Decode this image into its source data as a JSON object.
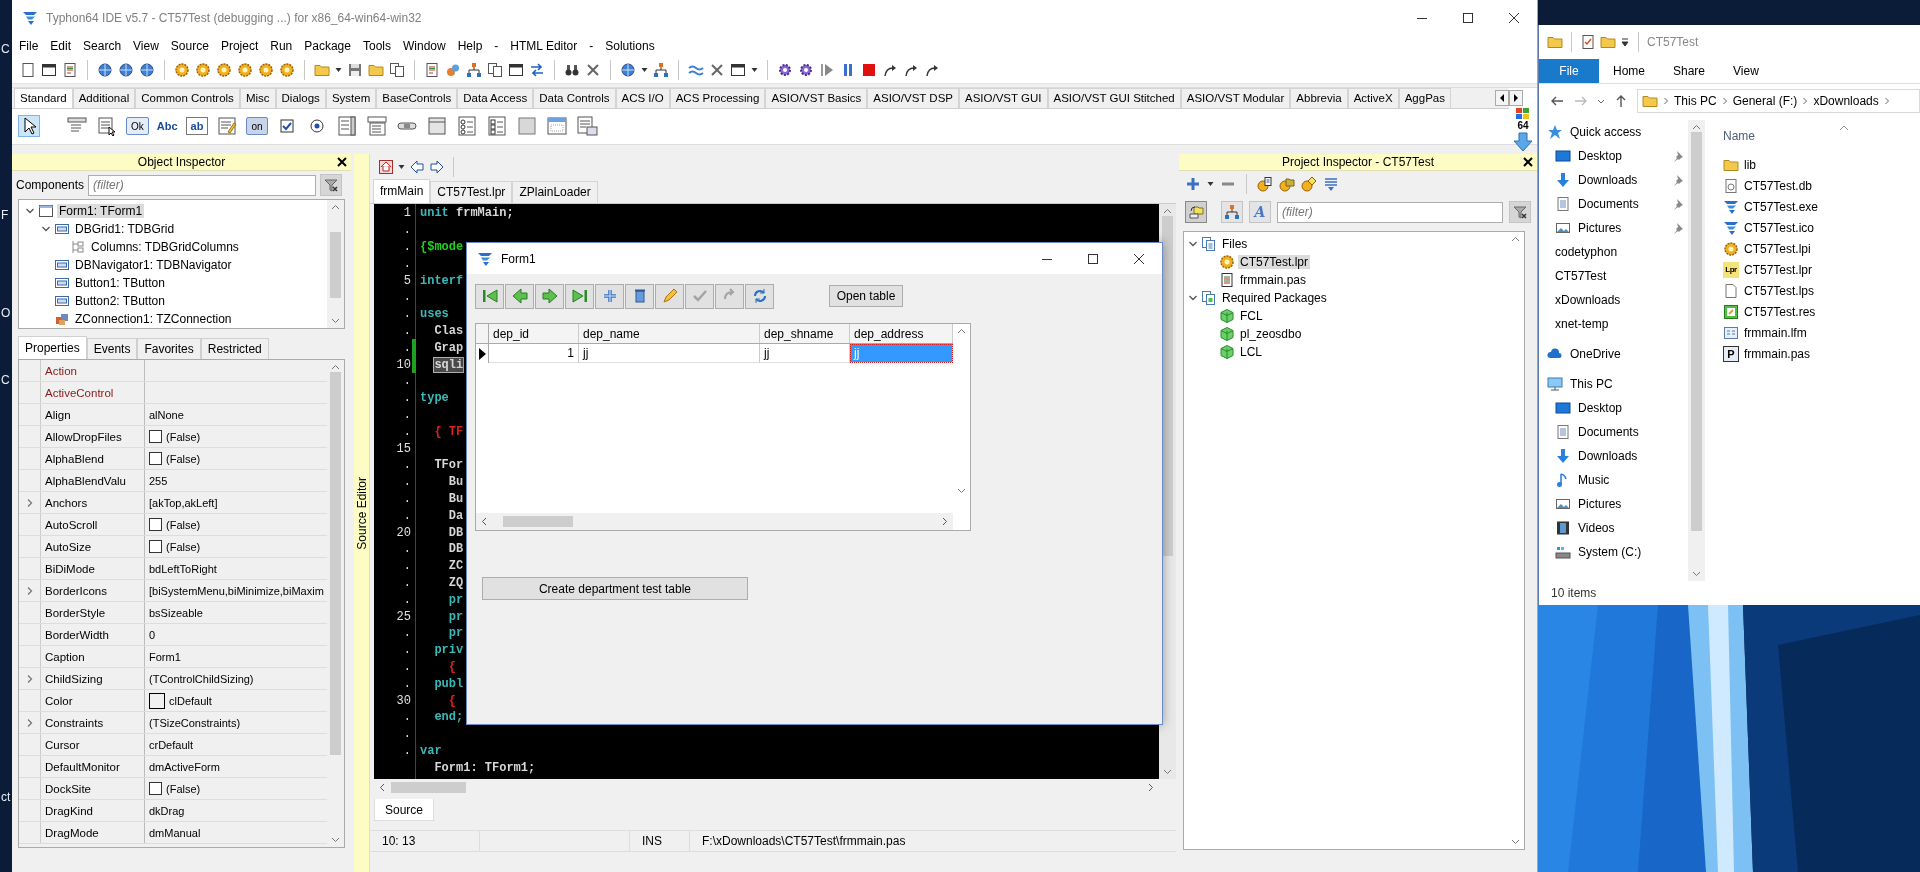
{
  "desktop": {
    "icon_labels": [
      "C",
      "F",
      "O",
      "C",
      "ct"
    ]
  },
  "ide": {
    "title": "Typhon64 IDE v5.7 - CT57Test (debugging ...) for x86_64-win64-win32",
    "menu": [
      "File",
      "Edit",
      "Search",
      "View",
      "Source",
      "Project",
      "Run",
      "Package",
      "Tools",
      "Window",
      "Help",
      "-",
      "HTML Editor",
      "-",
      "Solutions"
    ],
    "palette": {
      "tabs": [
        {
          "label": "Standard",
          "selected": true
        },
        {
          "label": "Additional",
          "selected": false
        },
        {
          "label": "Common Controls",
          "selected": false
        },
        {
          "label": "Misc",
          "selected": false
        },
        {
          "label": "Dialogs",
          "selected": false
        },
        {
          "label": "System",
          "selected": false
        },
        {
          "label": "BaseControls",
          "selected": false
        },
        {
          "label": "Data Access",
          "selected": false
        },
        {
          "label": "Data Controls",
          "selected": false
        },
        {
          "label": "ACS I/O",
          "selected": false
        },
        {
          "label": "ACS Processing",
          "selected": false
        },
        {
          "label": "ASIO/VST Basics",
          "selected": false
        },
        {
          "label": "ASIO/VST DSP",
          "selected": false
        },
        {
          "label": "ASIO/VST GUI",
          "selected": false
        },
        {
          "label": "ASIO/VST GUI Stitched",
          "selected": false
        },
        {
          "label": "ASIO/VST Modular",
          "selected": false
        },
        {
          "label": "Abbrevia",
          "selected": false
        },
        {
          "label": "ActiveX",
          "selected": false
        },
        {
          "label": "AggPas",
          "selected": false
        }
      ],
      "components": [
        {
          "kind": "pointer",
          "selected": true
        },
        {
          "kind": "menu",
          "selected": false
        },
        {
          "kind": "popup",
          "selected": false
        },
        {
          "kind": "button",
          "glyph": "Ok",
          "selected": false
        },
        {
          "kind": "label",
          "glyph": "Abc",
          "selected": false
        },
        {
          "kind": "edit",
          "glyph": "ab",
          "selected": false
        },
        {
          "kind": "memo",
          "selected": false
        },
        {
          "kind": "toggle",
          "glyph": "on",
          "selected": false
        },
        {
          "kind": "checkbox",
          "selected": false
        },
        {
          "kind": "radio",
          "selected": false
        },
        {
          "kind": "listbox",
          "selected": false
        },
        {
          "kind": "combobox",
          "selected": false
        },
        {
          "kind": "scrollbar",
          "selected": false
        },
        {
          "kind": "groupbox",
          "selected": false
        },
        {
          "kind": "radiogroup",
          "selected": false
        },
        {
          "kind": "checkgroup",
          "selected": false
        },
        {
          "kind": "panel",
          "selected": false
        },
        {
          "kind": "frame",
          "selected": false
        },
        {
          "kind": "actionlist",
          "selected": false
        }
      ],
      "badge": "64"
    },
    "object_inspector": {
      "title": "Object Inspector",
      "components_label": "Components",
      "filter_placeholder": "(filter)",
      "tree": [
        {
          "label": "Form1: TForm1",
          "kind": "form",
          "selected": true,
          "expanded": true,
          "children": [
            {
              "label": "DBGrid1: TDBGrid",
              "kind": "grid",
              "selected": false,
              "expanded": true,
              "children": [
                {
                  "label": "Columns: TDBGridColumns",
                  "kind": "columns",
                  "selected": false
                }
              ]
            },
            {
              "label": "DBNavigator1: TDBNavigator",
              "kind": "control",
              "selected": false
            },
            {
              "label": "Button1: TButton",
              "kind": "control",
              "selected": false
            },
            {
              "label": "Button2: TButton",
              "kind": "control",
              "selected": false
            },
            {
              "label": "ZConnection1: TZConnection",
              "kind": "connection",
              "selected": false
            }
          ]
        }
      ],
      "tabs": [
        {
          "label": "Properties",
          "selected": true
        },
        {
          "label": "Events",
          "selected": false
        },
        {
          "label": "Favorites",
          "selected": false
        },
        {
          "label": "Restricted",
          "selected": false
        }
      ],
      "properties": [
        {
          "name": "Action",
          "kind": "reference",
          "expandable": false
        },
        {
          "name": "ActiveControl",
          "kind": "reference",
          "expandable": false
        },
        {
          "name": "Align",
          "value": "alNone",
          "kind": "text",
          "expandable": false
        },
        {
          "name": "AllowDropFiles",
          "value": "(False)",
          "kind": "check",
          "checked": false,
          "expandable": false
        },
        {
          "name": "AlphaBlend",
          "value": "(False)",
          "kind": "check",
          "checked": false,
          "expandable": false
        },
        {
          "name": "AlphaBlendValu",
          "value": "255",
          "kind": "text",
          "expandable": false
        },
        {
          "name": "Anchors",
          "value": "[akTop,akLeft]",
          "kind": "text",
          "expandable": true
        },
        {
          "name": "AutoScroll",
          "value": "(False)",
          "kind": "check",
          "checked": false,
          "expandable": false
        },
        {
          "name": "AutoSize",
          "value": "(False)",
          "kind": "check",
          "checked": false,
          "expandable": false
        },
        {
          "name": "BiDiMode",
          "value": "bdLeftToRight",
          "kind": "text",
          "expandable": false
        },
        {
          "name": "BorderIcons",
          "value": "[biSystemMenu,biMinimize,biMaxim",
          "kind": "text",
          "expandable": true
        },
        {
          "name": "BorderStyle",
          "value": "bsSizeable",
          "kind": "text",
          "expandable": false
        },
        {
          "name": "BorderWidth",
          "value": "0",
          "kind": "text",
          "expandable": false
        },
        {
          "name": "Caption",
          "value": "Form1",
          "kind": "text",
          "expandable": false
        },
        {
          "name": "ChildSizing",
          "value": "(TControlChildSizing)",
          "kind": "text",
          "expandable": true
        },
        {
          "name": "Color",
          "value": "clDefault",
          "kind": "color",
          "expandable": false
        },
        {
          "name": "Constraints",
          "value": "(TSizeConstraints)",
          "kind": "text",
          "expandable": true
        },
        {
          "name": "Cursor",
          "value": "crDefault",
          "kind": "text",
          "expandable": false
        },
        {
          "name": "DefaultMonitor",
          "value": "dmActiveForm",
          "kind": "text",
          "expandable": false
        },
        {
          "name": "DockSite",
          "value": "(False)",
          "kind": "check",
          "checked": false,
          "expandable": false
        },
        {
          "name": "DragKind",
          "value": "dkDrag",
          "kind": "text",
          "expandable": false
        },
        {
          "name": "DragMode",
          "value": "dmManual",
          "kind": "text",
          "expandable": false
        }
      ]
    },
    "source_editor": {
      "side_label": "Source Editor",
      "tabs": [
        {
          "label": "frmMain",
          "selected": true
        },
        {
          "label": "CT57Test.lpr",
          "selected": false
        },
        {
          "label": "ZPlainLoader",
          "selected": false
        }
      ],
      "lines": [
        {
          "number": "1",
          "tokens": [
            {
              "text": "unit",
              "kind": "keyword"
            },
            {
              "text": " frmMain;",
              "kind": "plain"
            }
          ],
          "modified": false,
          "highlighted": false
        },
        {
          "number": ".",
          "modified": false
        },
        {
          "number": ".",
          "text": "{$mode",
          "kind": "directive",
          "modified": false,
          "highlighted": false
        },
        {
          "number": ".",
          "modified": false
        },
        {
          "number": "5",
          "text": "interf",
          "kind": "keyword",
          "modified": false,
          "highlighted": false
        },
        {
          "number": ".",
          "modified": false
        },
        {
          "number": ".",
          "text": "uses",
          "kind": "keyword",
          "modified": false,
          "highlighted": false
        },
        {
          "number": ".",
          "text": "  Clas",
          "kind": "plain",
          "modified": false,
          "highlighted": false
        },
        {
          "number": ".",
          "text": "  Grap",
          "kind": "plain",
          "modified": true,
          "highlighted": false
        },
        {
          "number": "10",
          "text": "  sqli",
          "kind": "plain",
          "modified": true,
          "highlighted": true
        },
        {
          "number": ".",
          "modified": false
        },
        {
          "number": ".",
          "text": "type",
          "kind": "keyword",
          "modified": false,
          "highlighted": false
        },
        {
          "number": ".",
          "modified": false
        },
        {
          "number": ".",
          "text": "  { TF",
          "kind": "comment",
          "modified": false,
          "highlighted": false
        },
        {
          "number": "15",
          "modified": false
        },
        {
          "number": ".",
          "text": "  TFor",
          "kind": "plain",
          "modified": false,
          "highlighted": false
        },
        {
          "number": ".",
          "text": "    Bu",
          "kind": "plain",
          "modified": false,
          "highlighted": false
        },
        {
          "number": ".",
          "text": "    Bu",
          "kind": "plain",
          "modified": false,
          "highlighted": false
        },
        {
          "number": ".",
          "text": "    Da",
          "kind": "plain",
          "modified": false,
          "highlighted": false
        },
        {
          "number": "20",
          "text": "    DB",
          "kind": "plain",
          "modified": false,
          "highlighted": false
        },
        {
          "number": ".",
          "text": "    DB",
          "kind": "plain",
          "modified": false,
          "highlighted": false
        },
        {
          "number": ".",
          "text": "    ZC",
          "kind": "plain",
          "modified": false,
          "highlighted": false
        },
        {
          "number": ".",
          "text": "    ZQ",
          "kind": "plain",
          "modified": false,
          "highlighted": false
        },
        {
          "number": ".",
          "text": "    pr",
          "kind": "keyword",
          "modified": false,
          "highlighted": false
        },
        {
          "number": "25",
          "text": "    pr",
          "kind": "keyword",
          "modified": false,
          "highlighted": false
        },
        {
          "number": ".",
          "text": "    pr",
          "kind": "keyword",
          "modified": false,
          "highlighted": false
        },
        {
          "number": ".",
          "text": "  priv",
          "kind": "keyword",
          "modified": false,
          "highlighted": false
        },
        {
          "number": ".",
          "text": "    {",
          "kind": "comment",
          "modified": false,
          "highlighted": false
        },
        {
          "number": ".",
          "text": "  publ",
          "kind": "keyword",
          "modified": false,
          "highlighted": false
        },
        {
          "number": "30",
          "text": "    {",
          "kind": "comment",
          "modified": false,
          "highlighted": false
        },
        {
          "number": ".",
          "text": "  end;",
          "kind": "keyword",
          "modified": false,
          "highlighted": false
        },
        {
          "number": ".",
          "modified": false
        },
        {
          "number": ".",
          "text": "var",
          "kind": "keyword",
          "modified": false,
          "highlighted": false
        },
        {
          "text": "  Form1: TForm1;",
          "kind": "plain",
          "modified": false,
          "highlighted": false
        }
      ],
      "bottom_tab": "Source",
      "status": {
        "position": "10: 13",
        "mode": "INS",
        "file": "F:\\xDownloads\\CT57Test\\frmmain.pas"
      }
    },
    "project_inspector": {
      "title": "Project Inspector - CT57Test",
      "sort_glyph": "A",
      "filter_placeholder": "(filter)",
      "tree": [
        {
          "label": "Files",
          "kind": "files",
          "selected": false,
          "expanded": true,
          "children": [
            {
              "label": "CT57Test.lpr",
              "kind": "project",
              "selected": true
            },
            {
              "label": "frmmain.pas",
              "kind": "unit",
              "selected": false
            }
          ]
        },
        {
          "label": "Required Packages",
          "kind": "packages",
          "selected": false,
          "expanded": true,
          "children": [
            {
              "label": "FCL",
              "kind": "package",
              "selected": false
            },
            {
              "label": "pl_zeosdbo",
              "kind": "package",
              "selected": false
            },
            {
              "label": "LCL",
              "kind": "package",
              "selected": false
            }
          ]
        }
      ]
    }
  },
  "form1": {
    "title": "Form1",
    "navigator": [
      {
        "kind": "first",
        "disabled": false
      },
      {
        "kind": "prior",
        "disabled": false
      },
      {
        "kind": "next",
        "disabled": false
      },
      {
        "kind": "last",
        "disabled": false
      },
      {
        "kind": "insert",
        "disabled": false
      },
      {
        "kind": "delete",
        "disabled": false
      },
      {
        "kind": "edit",
        "disabled": false
      },
      {
        "kind": "post",
        "disabled": true
      },
      {
        "kind": "cancel",
        "disabled": true
      },
      {
        "kind": "refresh",
        "disabled": false
      }
    ],
    "open_button": "Open table",
    "grid": {
      "columns": [
        {
          "title": "dep_id",
          "kind": "number"
        },
        {
          "title": "dep_name",
          "kind": "text"
        },
        {
          "title": "dep_shname",
          "kind": "text"
        },
        {
          "title": "dep_address",
          "kind": "text"
        }
      ],
      "rows": [
        {
          "current": true,
          "cells": [
            {
              "text": "1",
              "selected": false
            },
            {
              "text": "jj",
              "selected": false
            },
            {
              "text": "jj",
              "selected": false
            },
            {
              "text": "jj",
              "selected": true
            }
          ]
        }
      ]
    },
    "create_button": "Create department test table"
  },
  "explorer": {
    "title": "CT57Test",
    "ribbon_tabs": [
      {
        "label": "File",
        "selected": true
      },
      {
        "label": "Home",
        "selected": false
      },
      {
        "label": "Share",
        "selected": false
      },
      {
        "label": "View",
        "selected": false
      }
    ],
    "address": [
      "This PC",
      "General (F:)",
      "xDownloads"
    ],
    "nav": [
      {
        "label": "Quick access",
        "kind": "star",
        "children": [
          {
            "label": "Desktop",
            "kind": "desktop",
            "pinned": true
          },
          {
            "label": "Downloads",
            "kind": "download",
            "pinned": true
          },
          {
            "label": "Documents",
            "kind": "document",
            "pinned": true
          },
          {
            "label": "Pictures",
            "kind": "pictures",
            "pinned": true
          },
          {
            "label": "codetyphon",
            "kind": "folder",
            "pinned": false
          },
          {
            "label": "CT57Test",
            "kind": "folder",
            "pinned": false
          },
          {
            "label": "xDownloads",
            "kind": "folder",
            "pinned": false
          },
          {
            "label": "xnet-temp",
            "kind": "folder",
            "pinned": false
          }
        ]
      },
      {
        "label": "OneDrive",
        "kind": "cloud"
      },
      {
        "label": "This PC",
        "kind": "pc",
        "children": [
          {
            "label": "Desktop",
            "kind": "desktop"
          },
          {
            "label": "Documents",
            "kind": "document"
          },
          {
            "label": "Downloads",
            "kind": "download"
          },
          {
            "label": "Music",
            "kind": "music"
          },
          {
            "label": "Pictures",
            "kind": "pictures"
          },
          {
            "label": "Videos",
            "kind": "video"
          },
          {
            "label": "System (C:)",
            "kind": "drive"
          }
        ]
      }
    ],
    "column_header": "Name",
    "files": [
      {
        "name": "lib",
        "kind": "folder"
      },
      {
        "name": "CT57Test.db",
        "kind": "db"
      },
      {
        "name": "CT57Test.exe",
        "kind": "exe"
      },
      {
        "name": "CT57Test.ico",
        "kind": "ico"
      },
      {
        "name": "CT57Test.lpi",
        "kind": "lpi"
      },
      {
        "name": "CT57Test.lpr",
        "kind": "lpr",
        "glyph": "Lpr"
      },
      {
        "name": "CT57Test.lps",
        "kind": "lps"
      },
      {
        "name": "CT57Test.res",
        "kind": "res"
      },
      {
        "name": "frmmain.lfm",
        "kind": "lfm"
      },
      {
        "name": "frmmain.pas",
        "kind": "pas",
        "glyph": "P"
      }
    ],
    "status": "10 items"
  }
}
